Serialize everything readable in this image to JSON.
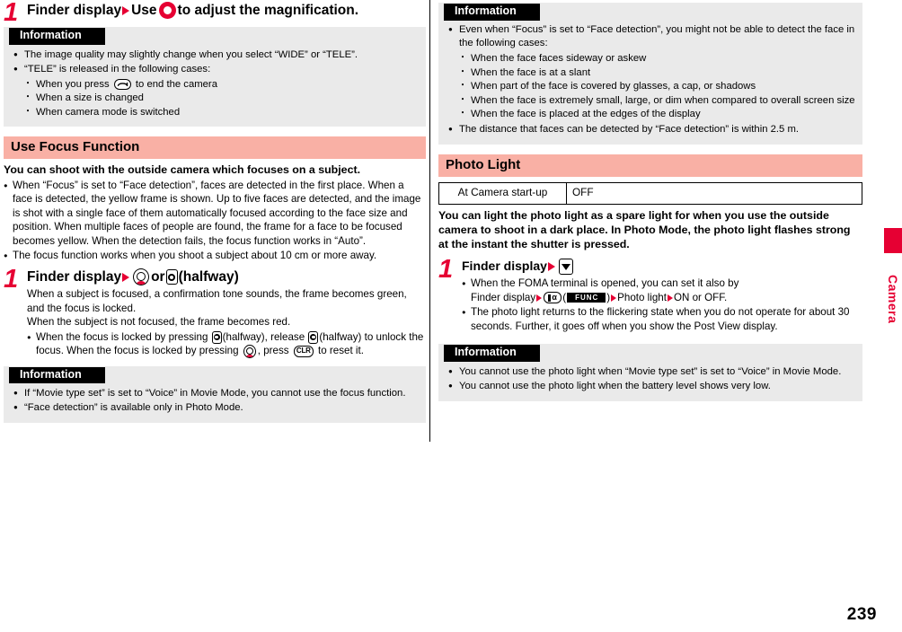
{
  "page": {
    "number": "239",
    "side_tab_label": "Camera",
    "accent_red": "#e60033",
    "section_band": "#f9b0a5",
    "info_bg": "#eaeaea"
  },
  "left": {
    "step_zoom": {
      "number": "1",
      "title_prefix": "Finder display",
      "title_mid": "Use",
      "title_suffix": "to adjust the magnification."
    },
    "info_zoom": {
      "heading": "Information",
      "items": [
        {
          "text": "The image quality may slightly change when you select “WIDE” or “TELE”."
        },
        {
          "text": "“TELE” is released in the following cases:"
        }
      ],
      "sub_items": [
        {
          "pre": "When you press",
          "post": "to end the camera"
        },
        {
          "text": "When a size is changed"
        },
        {
          "text": "When camera mode is switched"
        }
      ]
    },
    "section": {
      "title": "Use Focus Function",
      "lead": "You can shoot with the outside camera which focuses on a subject.",
      "bullets": [
        "When “Focus” is set to “Face detection”, faces are detected in the first place. When a face is detected, the yellow frame is shown. Up to five faces are detected, and the image is shot with a single face of them automatically focused according to the face size and position. When multiple faces of people are found, the frame for a face to be focused becomes yellow. When the detection fails, the focus function works in “Auto”.",
        "The focus function works when you shoot a subject about 10 cm or more away."
      ]
    },
    "step_focus": {
      "number": "1",
      "title_prefix": "Finder display",
      "title_or": "or",
      "title_halfway": "(halfway)",
      "body_line1": "When a subject is focused, a confirmation tone sounds, the frame becomes green, and the focus is locked.",
      "body_line2": "When the subject is not focused, the frame becomes red.",
      "bullet_p1": "When the focus is locked by pressing",
      "bullet_p2": "(halfway), release",
      "bullet_p3": "(halfway) to unlock the focus. When the focus is locked by pressing",
      "bullet_p4": ", press",
      "bullet_p5": "to reset it.",
      "clr_key": "CLR"
    },
    "info_focus": {
      "heading": "Information",
      "items": [
        "If “Movie type set” is set to “Voice” in Movie Mode, you cannot use the focus function.",
        "“Face detection” is available only in Photo Mode."
      ]
    }
  },
  "right": {
    "info_face": {
      "heading": "Information",
      "item1": "Even when “Focus” is set to “Face detection”, you might not be able to detect the face in the following cases:",
      "sub_items": [
        "When the face faces sideway or askew",
        "When the face is at a slant",
        "When part of the face is covered by glasses, a cap, or shadows",
        "When the face is extremely small, large, or dim when compared to overall screen size",
        "When the face is placed at the edges of the display"
      ],
      "item2": "The distance that faces can be detected by “Face detection” is within 2.5 m."
    },
    "section": {
      "title": "Photo Light",
      "table": {
        "rows": [
          {
            "label": "At Camera start-up",
            "value": "OFF"
          }
        ]
      },
      "lead": "You can light the photo light as a spare light for when you use the outside camera to shoot in a dark place. In Photo Mode, the photo light flashes strong at the instant the shutter is pressed."
    },
    "step_light": {
      "number": "1",
      "title_prefix": "Finder display",
      "bullet1_p1": "When the FOMA terminal is opened, you can set it also by",
      "bullet1_p2": "Finder display",
      "bullet1_func": "FUNC",
      "bullet1_p3": "Photo light",
      "bullet1_p4": "ON or OFF.",
      "bullet2": "The photo light returns to the flickering state when you do not operate for about 30 seconds. Further, it goes off when you show the Post View display."
    },
    "info_light": {
      "heading": "Information",
      "items": [
        "You cannot use the photo light when “Movie type set” is set to “Voice” in Movie Mode.",
        "You cannot use the photo light when the battery level shows very low."
      ]
    }
  }
}
